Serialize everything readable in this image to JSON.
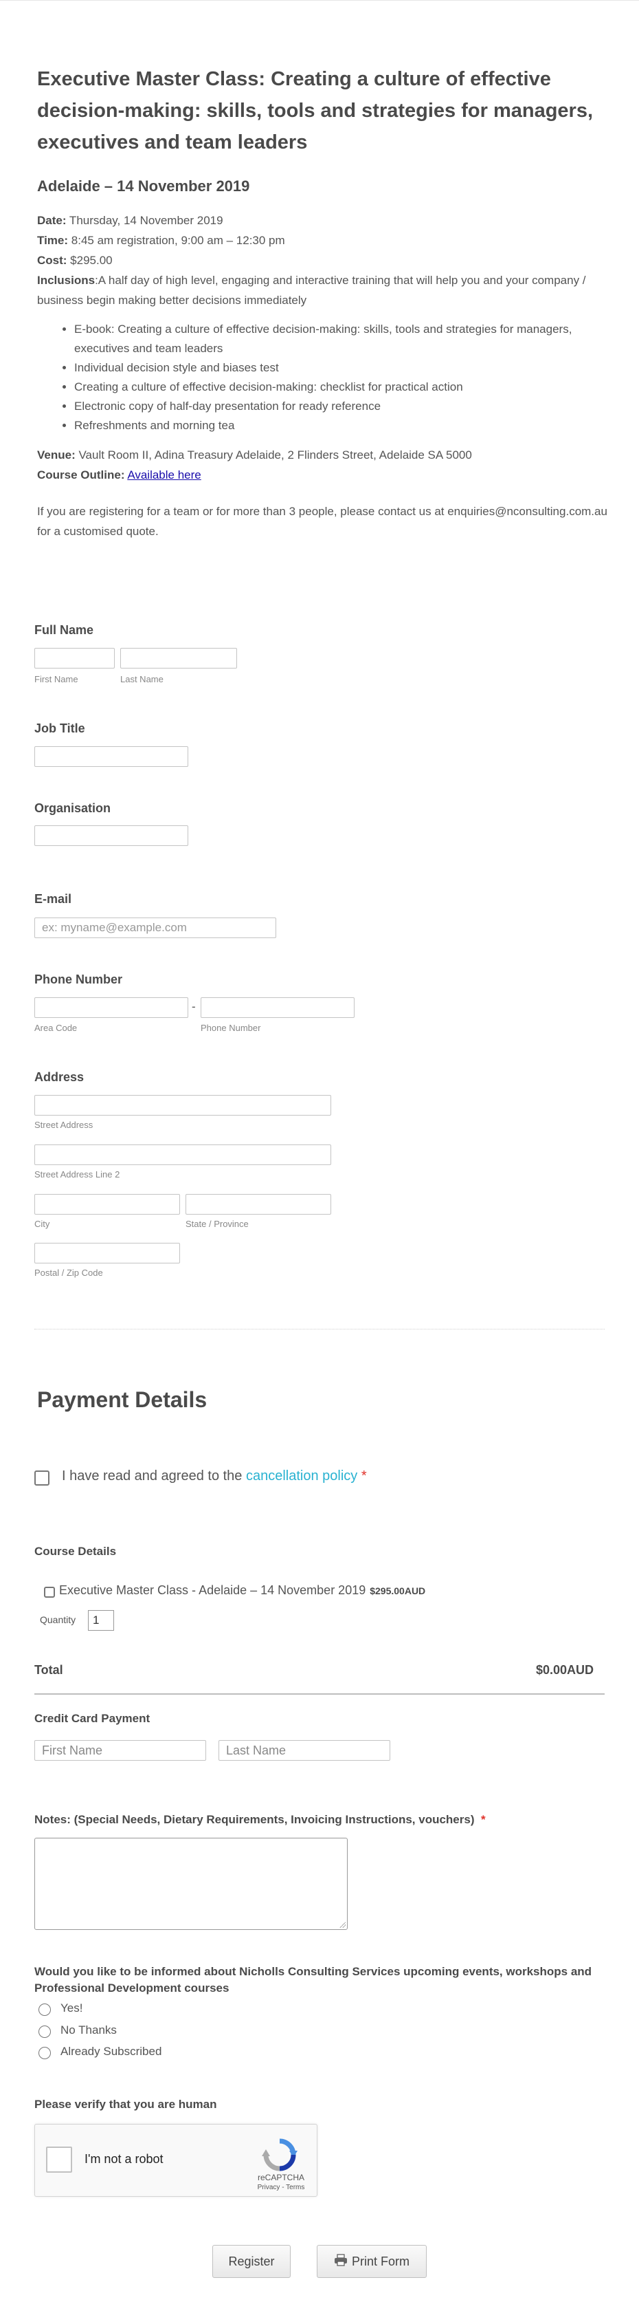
{
  "intro": {
    "title": "Executive Master Class: Creating a culture of effective decision-making: skills, tools and strategies for managers, executives and team leaders",
    "subtitle": "Adelaide – 14 November 2019",
    "date_label": "Date:",
    "date_value": " Thursday, 14 November 2019",
    "time_label": "Time:",
    "time_value": " 8:45 am registration, 9:00 am – 12:30 pm",
    "cost_label": "Cost:",
    "cost_value": " $295.00",
    "inclusions_label": "Inclusions",
    "inclusions_value": ":A half day of high level, engaging and interactive training that will help you and your company / business begin making better decisions immediately",
    "bullets": [
      "E-book: Creating a culture of effective decision-making: skills, tools and strategies for managers, executives and team leaders",
      "Individual decision style and biases test",
      "Creating a culture of effective decision-making: checklist for practical action",
      "Electronic copy of half-day presentation for ready reference",
      "Refreshments and morning tea"
    ],
    "venue_label": "Venue:",
    "venue_value": " Vault Room II, Adina Treasury Adelaide, 2 Flinders Street, Adelaide SA 5000",
    "outline_label": "Course Outline:",
    "outline_link": "Available here",
    "contact": "If you are registering for a team or for more than 3 people, please contact us at enquiries@nconsulting.com.au for a customised quote."
  },
  "form": {
    "full_name_label": "Full Name",
    "first_name_sub": "First Name",
    "last_name_sub": "Last Name",
    "job_title_label": "Job Title",
    "organisation_label": "Organisation",
    "email_label": "E-mail",
    "email_placeholder": "ex: myname@example.com",
    "phone_label": "Phone Number",
    "phone_dash": "-",
    "area_code_sub": "Area Code",
    "phone_number_sub": "Phone Number",
    "address_label": "Address",
    "street_sub": "Street Address",
    "street2_sub": "Street Address Line 2",
    "city_sub": "City",
    "state_sub": "State / Province",
    "postal_sub": "Postal / Zip Code"
  },
  "payment": {
    "heading": "Payment Details",
    "agree_prefix": "I have read and agreed to the ",
    "agree_link": "cancellation policy",
    "agree_required": "*",
    "course_details_label": "Course Details",
    "course_item": "Executive Master Class - Adelaide – 14 November 2019",
    "course_price": "$295.00AUD",
    "quantity_label": "Quantity",
    "quantity_value": "1",
    "total_label": "Total",
    "total_value": "$0.00AUD",
    "cc_label": "Credit Card Payment",
    "cc_first_placeholder": "First Name",
    "cc_last_placeholder": "Last Name",
    "notes_label": "Notes: (Special Needs, Dietary Requirements, Invoicing Instructions, vouchers)",
    "notes_required": "*",
    "inform_question": "Would you like to be informed about Nicholls Consulting Services  upcoming events, workshops and Professional Development courses",
    "inform_options": [
      "Yes!",
      "No Thanks",
      "Already Subscribed"
    ],
    "verify_label": "Please verify that you are human",
    "captcha_text": "I'm not a robot",
    "captcha_brand": "reCAPTCHA",
    "captcha_terms": "Privacy - Terms",
    "register_button": "Register",
    "print_button": "Print Form"
  },
  "colors": {
    "accent_link": "#29b2d1",
    "required": "#e0322a",
    "text": "#555555",
    "heading": "#4a4a4a"
  }
}
